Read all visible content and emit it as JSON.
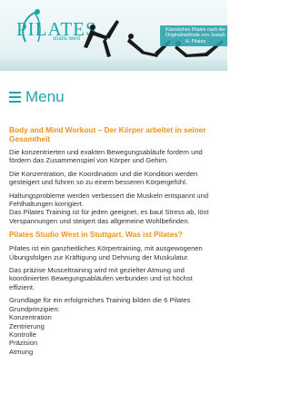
{
  "banner": {
    "logo_text": "PILATES",
    "logo_sub": "studio west",
    "claim": "Klassisches Pilates nach der Originalmethode von Joseph H. Pilates"
  },
  "nav": {
    "menu_label": "Menu",
    "menu_icon": "hamburger-icon"
  },
  "colors": {
    "accent": "#1ea7a7",
    "heading": "#e8931a"
  },
  "section1": {
    "title": "Body and Mind Workout – Der Körper arbeitet in seiner Gesamtheit",
    "p1": "Die konzentrierten und exakten Bewegungsabläufe fordern und fördern das Zusammenspiel von Körper und Gehirn.",
    "p2": "Die Konzentration, die Koordination und die Kondition werden gesteigert und führen so zu einem besseren Körpergefühl.",
    "p3": "Haltungsprobleme werden verbessert die Muskeln entspannt und Fehlhaltungen korrigiert.",
    "p4": "Das Pilates Training ist für jeden geeignet, es baut Stress ab, löst Verspannungen und steigert das allgemeine Wohlbefinden."
  },
  "section2": {
    "title": "Pilates Studio West in Stuttgart. Was ist Pilates?",
    "p1": "Pilates ist ein ganzheitliches Körpertraining, mit ausgewogenen Übungsfolgen zur Kräftigung und Dehnung der Muskulatur.",
    "p2": "Das präzise Musceltraining wird mit gezielter Atmung und koordinierten Bewegungsabläufen verbunden und ist höchst effizient.",
    "p3": "Grundlage für ein erfolgreiches Training bilden die 6 Pilates Grundprinzipien:",
    "principles": [
      "Konzentration",
      "Zentrierung",
      "Kontrolle",
      "Präzision",
      "Atmung"
    ]
  }
}
